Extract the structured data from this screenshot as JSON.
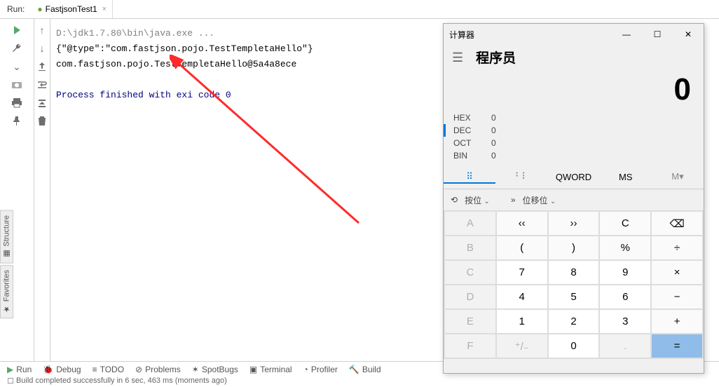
{
  "ide": {
    "run_label": "Run:",
    "tab": {
      "icon": "●",
      "name": "FastjsonTest1",
      "close": "×"
    },
    "console": {
      "cmd": "D:\\jdk1.7.80\\bin\\java.exe ...",
      "l1": "{\"@type\":\"com.fastjson.pojo.TestTempletaHello\"}",
      "l2": "com.fastjson.pojo.TestTempletaHello@5a4a8ece",
      "l3_a": "Process finished with exi",
      "l3_b": " code 0"
    },
    "side": {
      "structure": "Structure",
      "favorites": "Favorites"
    },
    "bottom": {
      "run": "Run",
      "debug": "Debug",
      "todo": "TODO",
      "problems": "Problems",
      "spotbugs": "SpotBugs",
      "terminal": "Terminal",
      "profiler": "Profiler",
      "build": "Build"
    },
    "status": "Build completed successfully in 6 sec, 463 ms (moments ago)"
  },
  "calc": {
    "title": "计算器",
    "mode": "程序员",
    "value": "0",
    "bases": {
      "hexL": "HEX",
      "hexV": "0",
      "decL": "DEC",
      "decV": "0",
      "octL": "OCT",
      "octV": "0",
      "binL": "BIN",
      "binV": "0"
    },
    "views": {
      "keypad": "⠿",
      "bits": "⠃⠇",
      "qword": "QWORD",
      "ms": "MS",
      "mr": "M▾"
    },
    "ctrl": {
      "bit": "按位",
      "shift": "位移位"
    },
    "keys": {
      "A": "A",
      "lsh": "‹‹",
      "rsh": "››",
      "C": "C",
      "bksp": "⌫",
      "B": "B",
      "lp": "(",
      "rp": ")",
      "pct": "%",
      "div": "÷",
      "Ck": "C",
      "k7": "7",
      "k8": "8",
      "k9": "9",
      "mul": "×",
      "D": "D",
      "k4": "4",
      "k5": "5",
      "k6": "6",
      "sub": "−",
      "E": "E",
      "k1": "1",
      "k2": "2",
      "k3": "3",
      "add": "+",
      "F": "F",
      "pm": "⁺/₋",
      "k0": "0",
      "dot": ".",
      "eq": "="
    }
  }
}
